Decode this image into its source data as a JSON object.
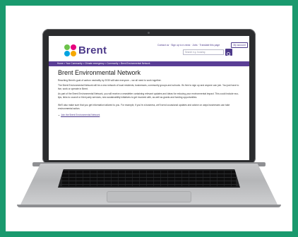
{
  "brand": {
    "name": "Brent"
  },
  "header": {
    "top_links": "Contact us  ·  Sign up to e-news  ·  Jobs  ·  Translate this page",
    "account_label": "My account",
    "search_placeholder": "Search e.g. housing"
  },
  "breadcrumb": "Home  >  Your Community  >  Climate emergency  >  Community  >  Brent Environmental Network",
  "page": {
    "title": "Brent Environmental Network",
    "paragraphs": [
      "Reaching Brent's goal of carbon neutrality by 2030 will take everyone – we all need to work together.",
      "The Brent Environmental Network will be a new network of local residents, businesses, community groups and schools. It's free to sign up and anyone can join. You just have to live, work or operate in Brent.",
      "As part of the Brent Environmental Network, you will receive a newsletter containing relevant updates and ideas for reducing your environmental impact. This could include eco-tips, links to council or third party services, new sustainability initiatives to get involved with, as well as grants and funding opportunities.",
      "We'll also make sure that you get information tailored to you. For example, if you're a business, we'll send occasional updates and advice on ways businesses can take environmental action."
    ],
    "link": "Join the Brent Environmental Network"
  }
}
